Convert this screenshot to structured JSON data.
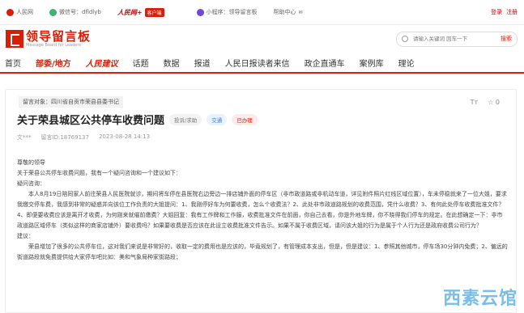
{
  "topbar": {
    "people": "人民网",
    "wechat": "微信号：dfldlyb",
    "people_logo": "人民网+",
    "client": "客户端",
    "mini": "小程序：领导留言板",
    "help": "帮助中心",
    "login": "登录",
    "register": "注册"
  },
  "header": {
    "logo_cn": "领导留言板",
    "logo_en": "Message Board for Leaders",
    "search_placeholder": "请输入关键词 回车一下",
    "search_button": "搜索"
  },
  "nav": [
    "首页",
    "部委/地方",
    "人民建议",
    "话题",
    "数据",
    "报道",
    "人民日报读者来信",
    "政企直通车",
    "案例库",
    "理论"
  ],
  "message": {
    "target": "留言对象：四川省自贡市荣县县委书记",
    "title": "关于荣县城区公共停车收费问题",
    "badges": [
      "投诉/求助",
      "交通",
      "已办理"
    ],
    "tool_font": "Tт",
    "tool_like": "☆ 0",
    "author": "文***",
    "msg_id": "留言ID:18769137",
    "date": "2023-08-28 14:13",
    "body": [
      "尊敬的领导",
      "关于荣县公共停车收费问题，我有一个疑问咨询和一个建议如下：",
      "疑问咨询：",
      "本人8月19日陪同家人前往荣县人民医院就诊，期间将车停在县医院右边旁边一排店铺外面的停车区（非市政道路或非机动车道，详见附件照片红线区域位置），车未停稳就来了一位大姐，要求我缴交停车费，我感到非常的疑惑并向该位工作负责的大姐提问：1、我刚停好车为何要收费，怎么个收费法？2、此处非市政道路规划的收费范围，凭什么收费？3、有何此处停车收费批准文件？4、即便要收费应该是离开才收费，为何刚来就催前缴费？大姐回复：我有工作牌和工作服，收费批准文件在前面，你自己去看，你是外地车牌，你不晓得我们停车的规定。在此想确定一下：非市政道路区域停车（类似这样的商家店铺外）要收费吗？如果要收费是否应该在此设立收费批准文件告示。如果不属于收费区域，请问该大姐的行为是属于个人行为还是政府收费公司行为？",
      "建议：",
      "荣县增加了很多的公共停车位，这对我们来说是非常好的，收取一定的费用也是应该的，毕竟规划了，有管理成本支出，但是，但是建议：1、参照其他城市，停车场30分钟内免费；2、偏远的街道路段就免费提供给大家停车吧比如：美和气象局种家街路段；"
    ]
  },
  "watermark": "西素云馆"
}
